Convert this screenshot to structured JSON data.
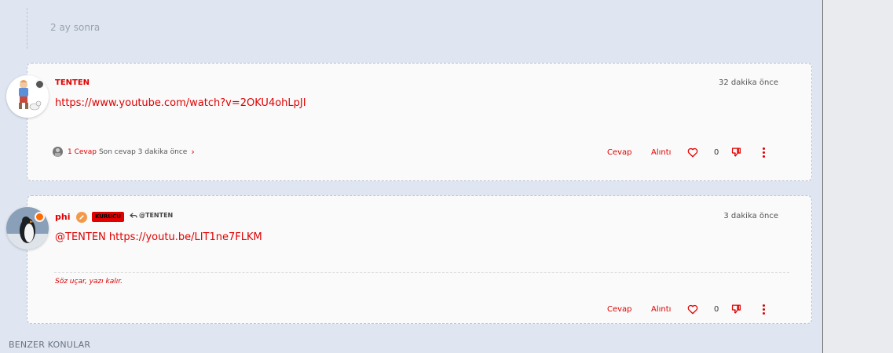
{
  "timeline": {
    "gap_label": "2 ay sonra"
  },
  "posts": [
    {
      "username": "TENTEN",
      "timestamp": "32 dakika önce",
      "content": "https://www.youtube.com/watch?v=2OKU4ohLpJI",
      "replies": {
        "count_label": "1 Cevap",
        "last_reply": "Son cevap 3 dakika önce"
      },
      "actions": {
        "reply": "Cevap",
        "quote": "Alıntı",
        "votes": "0"
      }
    },
    {
      "username": "phi",
      "group_badge": "KURUCU",
      "reply_to": "@TENTEN",
      "timestamp": "3 dakika önce",
      "content": "@TENTEN https://youtu.be/LIT1ne7FLKM",
      "signature": "Söz uçar, yazı kalır.",
      "actions": {
        "reply": "Cevap",
        "quote": "Alıntı",
        "votes": "0"
      }
    }
  ],
  "similar_topics": {
    "heading": "BENZER KONULAR"
  },
  "colors": {
    "accent": "#e00000",
    "background": "#dfe6f2",
    "card": "#fafafa"
  }
}
